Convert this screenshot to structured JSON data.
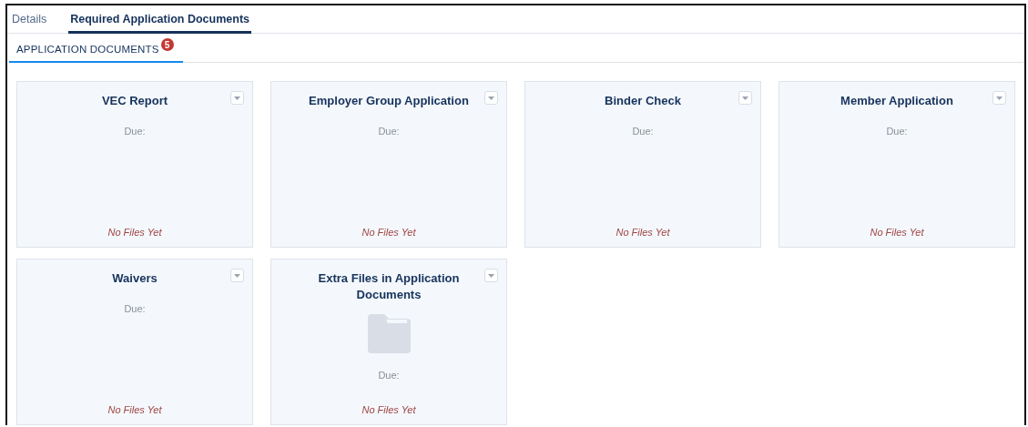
{
  "tabs": [
    {
      "label": "Details",
      "selected": false
    },
    {
      "label": "Required Application Documents",
      "selected": true
    }
  ],
  "subtabs": [
    {
      "label": "APPLICATION DOCUMENTS",
      "badge": "5",
      "selected": true
    }
  ],
  "cards": [
    {
      "title": "VEC Report",
      "kind": "plain",
      "due": "Due:",
      "files": "No Files Yet"
    },
    {
      "title": "Employer Group Application",
      "kind": "plain",
      "due": "Due:",
      "files": "No Files Yet"
    },
    {
      "title": "Binder Check",
      "kind": "plain",
      "due": "Due:",
      "files": "No Files Yet"
    },
    {
      "title": "Member Application",
      "kind": "plain",
      "due": "Due:",
      "files": "No Files Yet"
    },
    {
      "title": "Waivers",
      "kind": "plain",
      "due": "Due:",
      "files": "No Files Yet"
    },
    {
      "title": "Extra Files in Application Documents",
      "kind": "folder",
      "due": "Due:",
      "files": "No Files Yet"
    }
  ]
}
